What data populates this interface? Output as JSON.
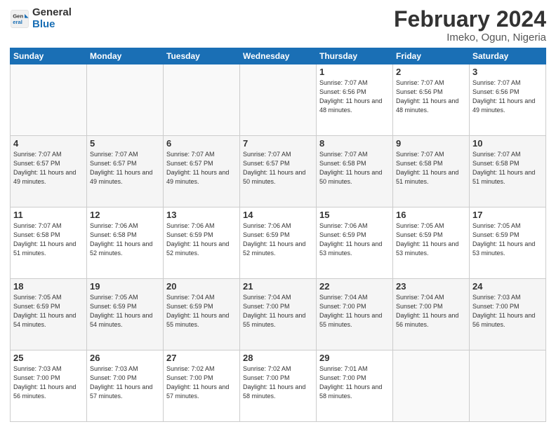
{
  "logo": {
    "line1": "General",
    "line2": "Blue"
  },
  "title": "February 2024",
  "location": "Imeko, Ogun, Nigeria",
  "days_of_week": [
    "Sunday",
    "Monday",
    "Tuesday",
    "Wednesday",
    "Thursday",
    "Friday",
    "Saturday"
  ],
  "weeks": [
    {
      "shade": false,
      "days": [
        {
          "num": "",
          "empty": true
        },
        {
          "num": "",
          "empty": true
        },
        {
          "num": "",
          "empty": true
        },
        {
          "num": "",
          "empty": true
        },
        {
          "num": "1",
          "sunrise": "7:07 AM",
          "sunset": "6:56 PM",
          "daylight": "11 hours and 48 minutes."
        },
        {
          "num": "2",
          "sunrise": "7:07 AM",
          "sunset": "6:56 PM",
          "daylight": "11 hours and 48 minutes."
        },
        {
          "num": "3",
          "sunrise": "7:07 AM",
          "sunset": "6:56 PM",
          "daylight": "11 hours and 49 minutes."
        }
      ]
    },
    {
      "shade": true,
      "days": [
        {
          "num": "4",
          "sunrise": "7:07 AM",
          "sunset": "6:57 PM",
          "daylight": "11 hours and 49 minutes."
        },
        {
          "num": "5",
          "sunrise": "7:07 AM",
          "sunset": "6:57 PM",
          "daylight": "11 hours and 49 minutes."
        },
        {
          "num": "6",
          "sunrise": "7:07 AM",
          "sunset": "6:57 PM",
          "daylight": "11 hours and 49 minutes."
        },
        {
          "num": "7",
          "sunrise": "7:07 AM",
          "sunset": "6:57 PM",
          "daylight": "11 hours and 50 minutes."
        },
        {
          "num": "8",
          "sunrise": "7:07 AM",
          "sunset": "6:58 PM",
          "daylight": "11 hours and 50 minutes."
        },
        {
          "num": "9",
          "sunrise": "7:07 AM",
          "sunset": "6:58 PM",
          "daylight": "11 hours and 51 minutes."
        },
        {
          "num": "10",
          "sunrise": "7:07 AM",
          "sunset": "6:58 PM",
          "daylight": "11 hours and 51 minutes."
        }
      ]
    },
    {
      "shade": false,
      "days": [
        {
          "num": "11",
          "sunrise": "7:07 AM",
          "sunset": "6:58 PM",
          "daylight": "11 hours and 51 minutes."
        },
        {
          "num": "12",
          "sunrise": "7:06 AM",
          "sunset": "6:58 PM",
          "daylight": "11 hours and 52 minutes."
        },
        {
          "num": "13",
          "sunrise": "7:06 AM",
          "sunset": "6:59 PM",
          "daylight": "11 hours and 52 minutes."
        },
        {
          "num": "14",
          "sunrise": "7:06 AM",
          "sunset": "6:59 PM",
          "daylight": "11 hours and 52 minutes."
        },
        {
          "num": "15",
          "sunrise": "7:06 AM",
          "sunset": "6:59 PM",
          "daylight": "11 hours and 53 minutes."
        },
        {
          "num": "16",
          "sunrise": "7:05 AM",
          "sunset": "6:59 PM",
          "daylight": "11 hours and 53 minutes."
        },
        {
          "num": "17",
          "sunrise": "7:05 AM",
          "sunset": "6:59 PM",
          "daylight": "11 hours and 53 minutes."
        }
      ]
    },
    {
      "shade": true,
      "days": [
        {
          "num": "18",
          "sunrise": "7:05 AM",
          "sunset": "6:59 PM",
          "daylight": "11 hours and 54 minutes."
        },
        {
          "num": "19",
          "sunrise": "7:05 AM",
          "sunset": "6:59 PM",
          "daylight": "11 hours and 54 minutes."
        },
        {
          "num": "20",
          "sunrise": "7:04 AM",
          "sunset": "6:59 PM",
          "daylight": "11 hours and 55 minutes."
        },
        {
          "num": "21",
          "sunrise": "7:04 AM",
          "sunset": "7:00 PM",
          "daylight": "11 hours and 55 minutes."
        },
        {
          "num": "22",
          "sunrise": "7:04 AM",
          "sunset": "7:00 PM",
          "daylight": "11 hours and 55 minutes."
        },
        {
          "num": "23",
          "sunrise": "7:04 AM",
          "sunset": "7:00 PM",
          "daylight": "11 hours and 56 minutes."
        },
        {
          "num": "24",
          "sunrise": "7:03 AM",
          "sunset": "7:00 PM",
          "daylight": "11 hours and 56 minutes."
        }
      ]
    },
    {
      "shade": false,
      "days": [
        {
          "num": "25",
          "sunrise": "7:03 AM",
          "sunset": "7:00 PM",
          "daylight": "11 hours and 56 minutes."
        },
        {
          "num": "26",
          "sunrise": "7:03 AM",
          "sunset": "7:00 PM",
          "daylight": "11 hours and 57 minutes."
        },
        {
          "num": "27",
          "sunrise": "7:02 AM",
          "sunset": "7:00 PM",
          "daylight": "11 hours and 57 minutes."
        },
        {
          "num": "28",
          "sunrise": "7:02 AM",
          "sunset": "7:00 PM",
          "daylight": "11 hours and 58 minutes."
        },
        {
          "num": "29",
          "sunrise": "7:01 AM",
          "sunset": "7:00 PM",
          "daylight": "11 hours and 58 minutes."
        },
        {
          "num": "",
          "empty": true
        },
        {
          "num": "",
          "empty": true
        }
      ]
    }
  ]
}
